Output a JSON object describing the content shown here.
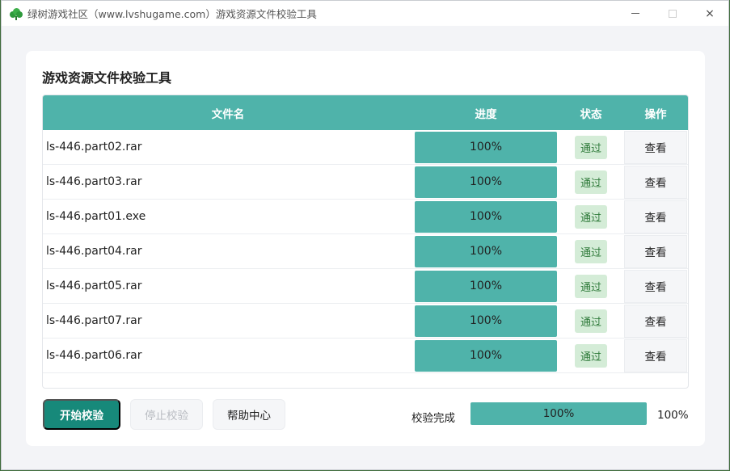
{
  "window": {
    "title": "绿树游戏社区（www.lvshugame.com）游戏资源文件校验工具",
    "controls": {
      "minimize": "minimize",
      "maximize": "maximize",
      "close": "×"
    }
  },
  "main": {
    "heading": "游戏资源文件校验工具",
    "table": {
      "columns": [
        "文件名",
        "进度",
        "状态",
        "操作"
      ],
      "rows": [
        {
          "name": "ls-446.part02.rar",
          "progress": 1.0,
          "progress_label": "100%",
          "status": "通过",
          "action": "查看"
        },
        {
          "name": "ls-446.part03.rar",
          "progress": 1.0,
          "progress_label": "100%",
          "status": "通过",
          "action": "查看"
        },
        {
          "name": "ls-446.part01.exe",
          "progress": 1.0,
          "progress_label": "100%",
          "status": "通过",
          "action": "查看"
        },
        {
          "name": "ls-446.part04.rar",
          "progress": 1.0,
          "progress_label": "100%",
          "status": "通过",
          "action": "查看"
        },
        {
          "name": "ls-446.part05.rar",
          "progress": 1.0,
          "progress_label": "100%",
          "status": "通过",
          "action": "查看"
        },
        {
          "name": "ls-446.part07.rar",
          "progress": 1.0,
          "progress_label": "100%",
          "status": "通过",
          "action": "查看"
        },
        {
          "name": "ls-446.part06.rar",
          "progress": 1.0,
          "progress_label": "100%",
          "status": "通过",
          "action": "查看"
        }
      ]
    },
    "buttons": {
      "start": "开始校验",
      "stop": "停止校验",
      "help": "帮助中心"
    },
    "overall": {
      "label": "校验完成",
      "progress": 1.0,
      "bar_label": "100%",
      "percent_text": "100%"
    }
  },
  "colors": {
    "accent": "#4fb3aa",
    "primary_button": "#17897a",
    "pass_badge_bg": "#d4ecd7",
    "pass_badge_text": "#2f7a3a"
  }
}
